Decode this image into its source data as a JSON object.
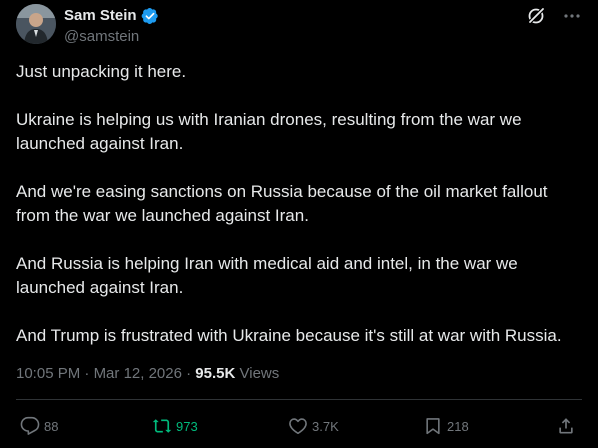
{
  "author": {
    "display_name": "Sam Stein",
    "handle": "@samstein",
    "verified": true
  },
  "paragraphs": [
    "Just unpacking it here.",
    "Ukraine is helping us with Iranian drones, resulting from the war we launched against Iran.",
    "And we're easing sanctions on Russia because of the oil market fallout from the war we launched against Iran.",
    "And Russia is helping Iran with medical aid and intel, in the war we launched against Iran.",
    "And Trump is frustrated with Ukraine because it's still at war with Russia."
  ],
  "meta": {
    "time": "10:05 PM",
    "separator": " · ",
    "date": "Mar 12, 2026",
    "views_count": "95.5K",
    "views_label": "Views"
  },
  "actions": {
    "replies": "88",
    "reposts": "973",
    "likes": "3.7K",
    "bookmarks": "218"
  },
  "icons": {
    "verified": "verified-badge-icon",
    "grok": "grok-icon",
    "more": "more-icon",
    "reply": "reply-icon",
    "repost": "repost-icon",
    "like": "like-icon",
    "bookmark": "bookmark-icon",
    "share": "share-icon"
  },
  "colors": {
    "background": "#000000",
    "text": "#e7e9ea",
    "muted": "#71767b",
    "verified": "#1d9bf0",
    "repost_active": "#00ba7c",
    "divider": "#2f3336"
  }
}
